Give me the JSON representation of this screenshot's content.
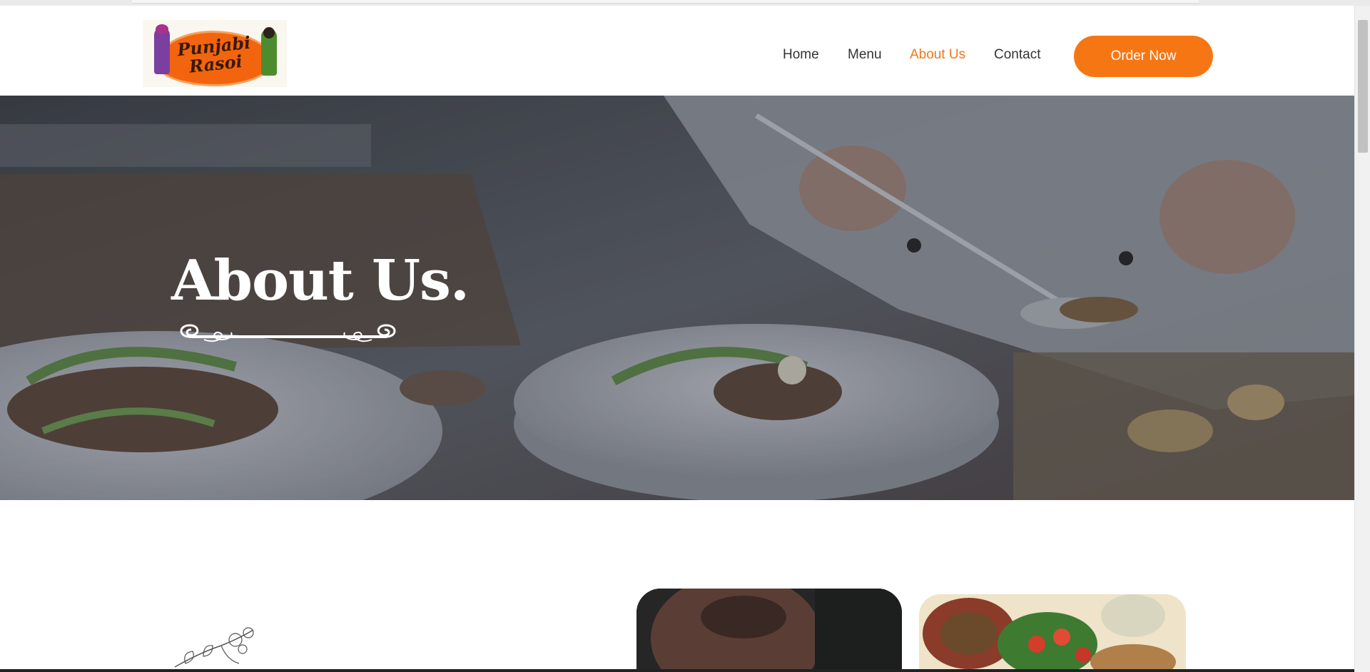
{
  "brand": {
    "logo_text": "Punjabi Rasoi"
  },
  "nav": {
    "items": [
      {
        "label": "Home"
      },
      {
        "label": "Menu"
      },
      {
        "label": "About Us"
      },
      {
        "label": "Contact"
      }
    ],
    "active": "About Us",
    "cta_label": "Order Now"
  },
  "hero": {
    "title": "About Us."
  },
  "colors": {
    "accent": "#f77614",
    "nav_text": "#333333",
    "hero_overlay": "#3c4048"
  },
  "icons": [
    "flourish-divider-icon",
    "floral-sketch-icon"
  ]
}
